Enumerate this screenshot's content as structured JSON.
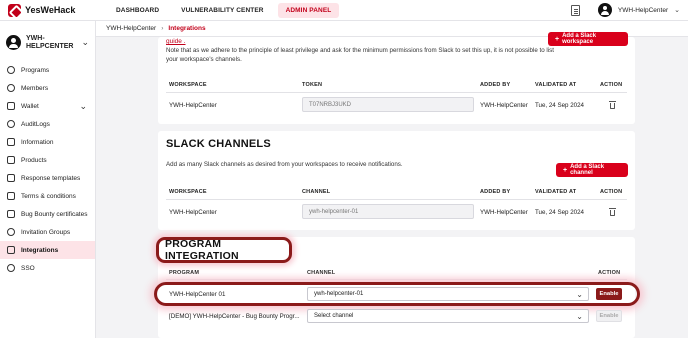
{
  "topbar": {
    "logo": "YesWeHack",
    "nav": [
      "DASHBOARD",
      "VULNERABILITY CENTER",
      "ADMIN PANEL"
    ],
    "active_nav": "ADMIN PANEL",
    "user": "YWH-HelpCenter"
  },
  "sidebar": {
    "org_name": "YWH-HELPCENTER",
    "items": [
      {
        "label": "Programs",
        "icon": "target-icon"
      },
      {
        "label": "Members",
        "icon": "users-icon"
      },
      {
        "label": "Wallet",
        "icon": "wallet-icon"
      },
      {
        "label": "AuditLogs",
        "icon": "log-icon"
      },
      {
        "label": "Information",
        "icon": "info-icon"
      },
      {
        "label": "Products",
        "icon": "box-icon"
      },
      {
        "label": "Response templates",
        "icon": "template-icon"
      },
      {
        "label": "Terms & conditions",
        "icon": "terms-icon"
      },
      {
        "label": "Bug Bounty certificates",
        "icon": "certificate-icon"
      },
      {
        "label": "Invitation Groups",
        "icon": "group-icon"
      },
      {
        "label": "Integrations",
        "icon": "link-icon"
      },
      {
        "label": "SSO",
        "icon": "key-icon"
      }
    ],
    "active_item": "Integrations"
  },
  "breadcrumb": {
    "parent": "YWH-HelpCenter",
    "current": "Integrations"
  },
  "workspaces": {
    "guide_link": "guide .",
    "note": "Note that as we adhere to the principle of least privilege and ask for the minimum permissions from Slack to set this up, it is not possible to list your workspace's channels.",
    "add_button": "Add a Slack workspace",
    "headers": [
      "WORKSPACE",
      "TOKEN",
      "ADDED BY",
      "VALIDATED AT",
      "ACTION"
    ],
    "rows": [
      {
        "workspace": "YWH-HelpCenter",
        "token": "T07NRBJ3UKD",
        "added_by": "YWH-HelpCenter",
        "validated_at": "Tue, 24 Sep 2024"
      }
    ]
  },
  "slack_channels": {
    "title": "SLACK CHANNELS",
    "description": "Add as many Slack channels as desired from your workspaces to receive notifications.",
    "add_button": "Add a Slack channel",
    "headers": [
      "WORKSPACE",
      "CHANNEL",
      "ADDED BY",
      "VALIDATED AT",
      "ACTION"
    ],
    "rows": [
      {
        "workspace": "YWH-HelpCenter",
        "channel": "ywh-helpcenter-01",
        "added_by": "YWH-HelpCenter",
        "validated_at": "Tue, 24 Sep 2024"
      }
    ]
  },
  "program_integration": {
    "title": "PROGRAM INTEGRATION",
    "headers": [
      "PROGRAM",
      "CHANNEL",
      "ACTION"
    ],
    "rows": [
      {
        "program": "YWH-HelpCenter 01",
        "channel": "ywh-helpcenter-01",
        "action": "Enable",
        "enabled_style": true
      },
      {
        "program": "[DEMO] YWH-HelpCenter - Bug Bounty Progr...",
        "channel": "Select channel",
        "action": "Enable",
        "enabled_style": false
      }
    ]
  }
}
